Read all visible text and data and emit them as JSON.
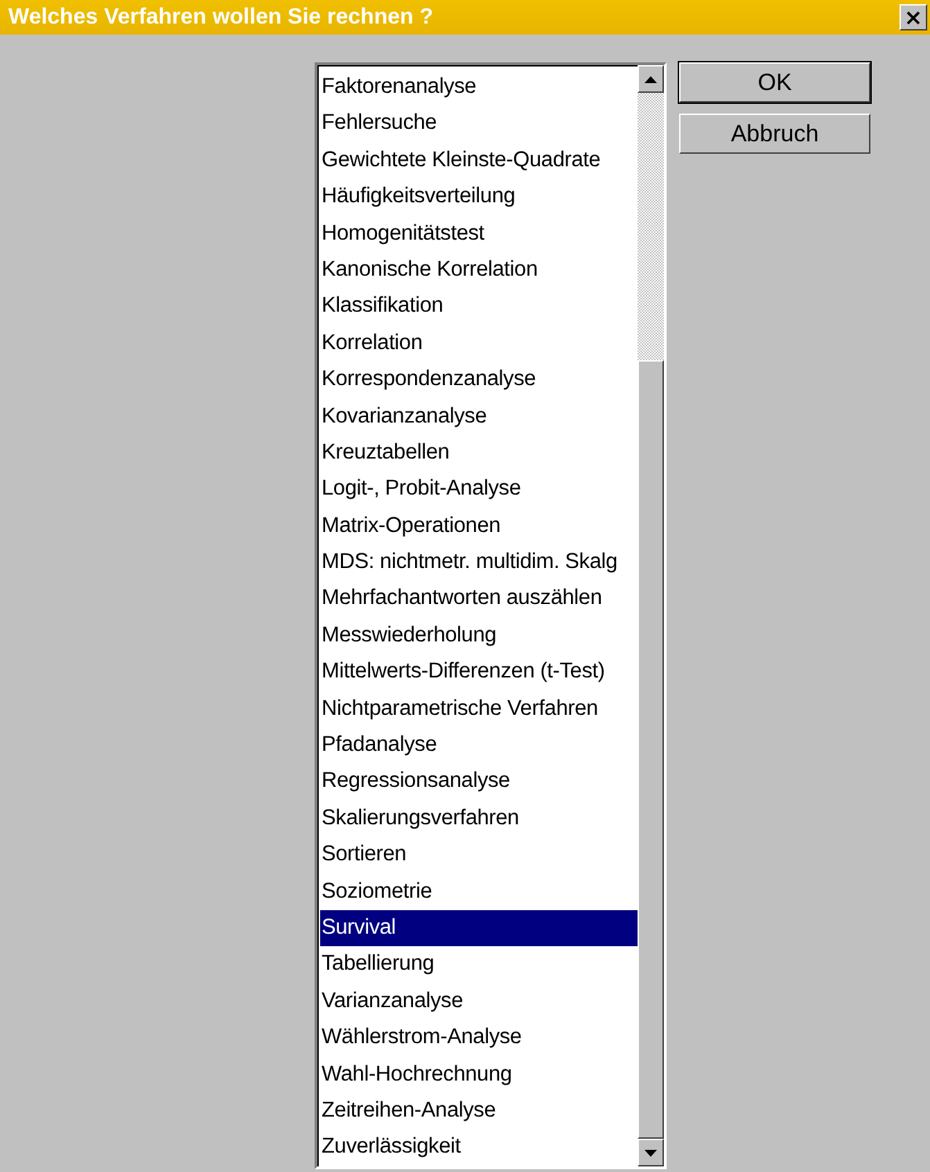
{
  "window": {
    "title": "Welches Verfahren wollen Sie rechnen ?",
    "close": "×"
  },
  "list": {
    "items": [
      {
        "label": "Faktorenanalyse",
        "selected": false
      },
      {
        "label": "Fehlersuche",
        "selected": false
      },
      {
        "label": "Gewichtete Kleinste-Quadrate",
        "selected": false
      },
      {
        "label": "Häufigkeitsverteilung",
        "selected": false
      },
      {
        "label": "Homogenitätstest",
        "selected": false
      },
      {
        "label": "Kanonische Korrelation",
        "selected": false
      },
      {
        "label": "Klassifikation",
        "selected": false
      },
      {
        "label": "Korrelation",
        "selected": false
      },
      {
        "label": "Korrespondenzanalyse",
        "selected": false
      },
      {
        "label": "Kovarianzanalyse",
        "selected": false
      },
      {
        "label": "Kreuztabellen",
        "selected": false
      },
      {
        "label": "Logit-, Probit-Analyse",
        "selected": false
      },
      {
        "label": "Matrix-Operationen",
        "selected": false
      },
      {
        "label": "MDS: nichtmetr. multidim. Skalg",
        "selected": false
      },
      {
        "label": "Mehrfachantworten auszählen",
        "selected": false
      },
      {
        "label": "Messwiederholung",
        "selected": false
      },
      {
        "label": "Mittelwerts-Differenzen (t-Test)",
        "selected": false
      },
      {
        "label": "Nichtparametrische Verfahren",
        "selected": false
      },
      {
        "label": "Pfadanalyse",
        "selected": false
      },
      {
        "label": "Regressionsanalyse",
        "selected": false
      },
      {
        "label": "Skalierungsverfahren",
        "selected": false
      },
      {
        "label": "Sortieren",
        "selected": false
      },
      {
        "label": "Soziometrie",
        "selected": false
      },
      {
        "label": "Survival",
        "selected": true
      },
      {
        "label": "Tabellierung",
        "selected": false
      },
      {
        "label": "Varianzanalyse",
        "selected": false
      },
      {
        "label": "Wählerstrom-Analyse",
        "selected": false
      },
      {
        "label": "Wahl-Hochrechnung",
        "selected": false
      },
      {
        "label": "Zeitreihen-Analyse",
        "selected": false
      },
      {
        "label": "Zuverlässigkeit",
        "selected": false
      }
    ]
  },
  "buttons": [
    "OK",
    "Abbruch"
  ]
}
